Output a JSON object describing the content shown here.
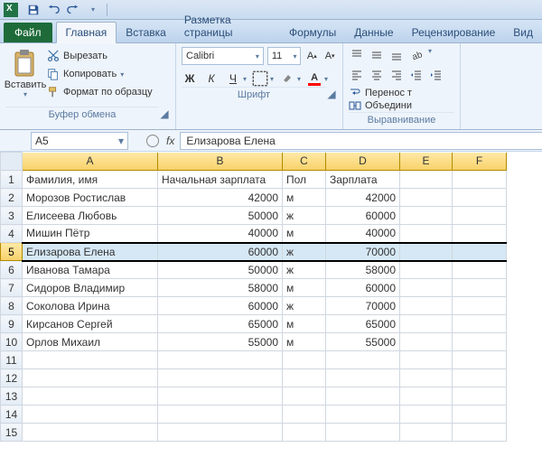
{
  "qat": {},
  "tabs": {
    "file": "Файл",
    "home": "Главная",
    "insert": "Вставка",
    "layout": "Разметка страницы",
    "formulas": "Формулы",
    "data": "Данные",
    "review": "Рецензирование",
    "view": "Вид"
  },
  "ribbon": {
    "clipboard": {
      "paste": "Вставить",
      "cut": "Вырезать",
      "copy": "Копировать",
      "format_painter": "Формат по образцу",
      "group_label": "Буфер обмена"
    },
    "font": {
      "name": "Calibri",
      "size": "11",
      "bold": "Ж",
      "italic": "К",
      "underline": "Ч",
      "fill_color": "#ffff00",
      "font_color": "#ff0000",
      "group_label": "Шрифт"
    },
    "alignment": {
      "wrap": "Перенос т",
      "merge": "Объедини",
      "group_label": "Выравнивание"
    }
  },
  "namebox": {
    "ref": "A5"
  },
  "formula": {
    "fx": "fx",
    "value": "Елизарова Елена"
  },
  "columns": [
    "A",
    "B",
    "C",
    "D",
    "E",
    "F"
  ],
  "selected_row": 5,
  "headers": {
    "a": "Фамилия, имя",
    "b": "Начальная зарплата",
    "c": "Пол",
    "d": "Зарплата"
  },
  "rows": [
    {
      "a": "Морозов Ростислав",
      "b": "42000",
      "c": "м",
      "d": "42000"
    },
    {
      "a": "Елисеева Любовь",
      "b": "50000",
      "c": "ж",
      "d": "60000"
    },
    {
      "a": "Мишин Пётр",
      "b": "40000",
      "c": "м",
      "d": "40000"
    },
    {
      "a": "Елизарова Елена",
      "b": "60000",
      "c": "ж",
      "d": "70000"
    },
    {
      "a": "Иванова Тамара",
      "b": "50000",
      "c": "ж",
      "d": "58000"
    },
    {
      "a": "Сидоров Владимир",
      "b": "58000",
      "c": "м",
      "d": "60000"
    },
    {
      "a": "Соколова Ирина",
      "b": "60000",
      "c": "ж",
      "d": "70000"
    },
    {
      "a": "Кирсанов Сергей",
      "b": "65000",
      "c": "м",
      "d": "65000"
    },
    {
      "a": "Орлов Михаил",
      "b": "55000",
      "c": "м",
      "d": "55000"
    }
  ]
}
